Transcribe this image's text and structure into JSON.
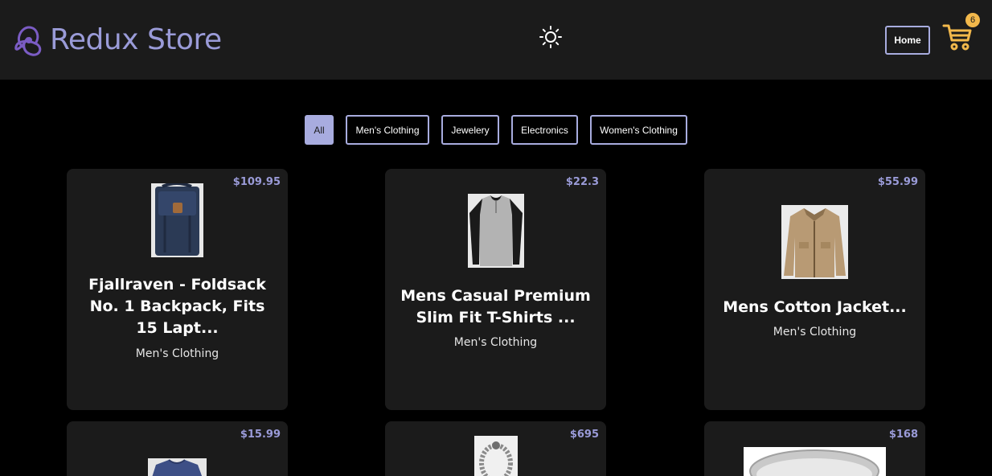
{
  "header": {
    "brand": "Redux Store",
    "home_label": "Home",
    "cart_count": "6",
    "theme_icon": "sun-icon",
    "cart_icon": "cart-icon",
    "logo_icon": "redux-logo-icon"
  },
  "filters": [
    {
      "label": "All",
      "active": true
    },
    {
      "label": "Men's Clothing",
      "active": false
    },
    {
      "label": "Jewelery",
      "active": false
    },
    {
      "label": "Electronics",
      "active": false
    },
    {
      "label": "Women's Clothing",
      "active": false
    }
  ],
  "products": [
    {
      "price": "$109.95",
      "title": "Fjallraven - Foldsack No. 1 Backpack, Fits 15 Lapt...",
      "category": "Men's Clothing",
      "image": "backpack"
    },
    {
      "price": "$22.3",
      "title": "Mens Casual Premium Slim Fit T-Shirts ...",
      "category": "Men's Clothing",
      "image": "raglan-tshirt"
    },
    {
      "price": "$55.99",
      "title": "Mens Cotton Jacket...",
      "category": "Men's Clothing",
      "image": "cotton-jacket"
    },
    {
      "price": "$15.99",
      "title": "",
      "category": "",
      "image": "sweater"
    },
    {
      "price": "$695",
      "title": "",
      "category": "",
      "image": "chain-bracelet"
    },
    {
      "price": "$168",
      "title": "",
      "category": "",
      "image": "ring"
    }
  ],
  "colors": {
    "accent": "#9a9bd8",
    "border": "#a8acdf",
    "badge": "#f2b84b",
    "card": "#1b1b1b",
    "background": "#000000"
  }
}
